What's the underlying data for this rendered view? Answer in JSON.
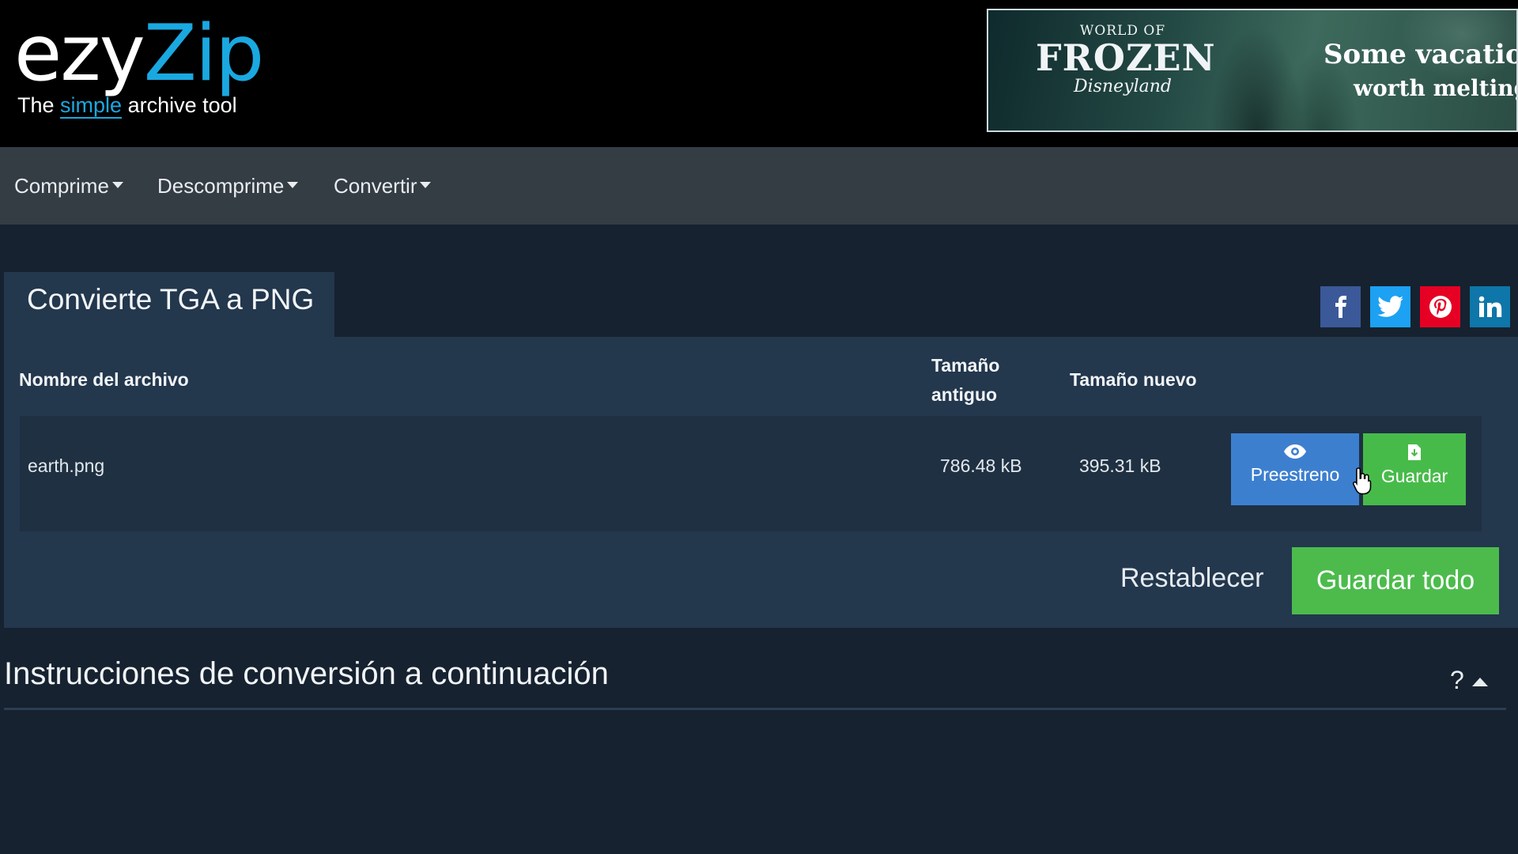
{
  "logo": {
    "ezy": "ezy",
    "zip": "Zip",
    "tagline_pre": "The ",
    "tagline_simple": "simple",
    "tagline_post": " archive tool"
  },
  "banner": {
    "world_of": "WORLD OF",
    "frozen": "FROZEN",
    "disneyland": "Disneyland",
    "line1": "Some vacations",
    "line2": "worth melting fo"
  },
  "nav": {
    "items": [
      {
        "label": "Comprime"
      },
      {
        "label": "Descomprime"
      },
      {
        "label": "Convertir"
      }
    ]
  },
  "tool": {
    "title": "Convierte TGA a PNG"
  },
  "share": [
    {
      "name": "facebook",
      "color": "#3b5998",
      "glyph": "f"
    },
    {
      "name": "twitter",
      "color": "#1da1f2",
      "glyph": "t"
    },
    {
      "name": "pinterest",
      "color": "#e60023",
      "glyph": "p"
    },
    {
      "name": "linkedin",
      "color": "#0e76a8",
      "glyph": "in"
    }
  ],
  "table": {
    "col_name": "Nombre del archivo",
    "col_old_line1": "Tamaño",
    "col_old_line2": "antiguo",
    "col_new": "Tamaño nuevo",
    "rows": [
      {
        "name": "earth.png",
        "old_size": "786.48 kB",
        "new_size": "395.31 kB",
        "preview_label": "Preestreno",
        "save_label": "Guardar"
      }
    ]
  },
  "actions": {
    "reset": "Restablecer",
    "save_all": "Guardar todo"
  },
  "instructions": {
    "title": "Instrucciones de conversión a continuación",
    "help": "?"
  },
  "colors": {
    "preview": "#3d7fcf",
    "save": "#47bb4a",
    "brand": "#1aa8e0"
  }
}
